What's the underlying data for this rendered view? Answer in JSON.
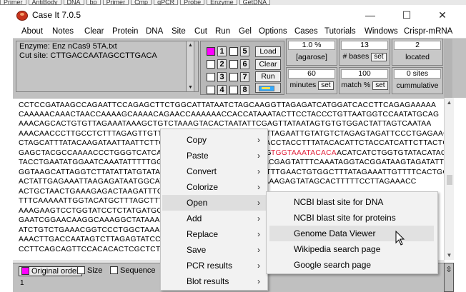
{
  "top_strip": [
    "Primer",
    "AntiBody",
    "DNA",
    "bp",
    "Primer",
    "Cmp",
    "qPCR",
    "Probe",
    "Enzyme",
    "GetDNA"
  ],
  "window": {
    "title": "Case It 7.0.5",
    "minimize": "—",
    "maximize": "☐",
    "close": "✕"
  },
  "menu": [
    "About",
    "Notes",
    "Clear",
    "Protein",
    "DNA",
    "Site",
    "Cut",
    "Run",
    "Gel",
    "Options",
    "Cases",
    "Tutorials",
    "Windows",
    "Crispr-mRNA"
  ],
  "info": {
    "line1": "Enzyme: Enz nCas9 5TA.txt",
    "line2": "Cut site: CTTGACCAATAGCCTTGACA"
  },
  "lanes": [
    "1",
    "2",
    "3",
    "4",
    "5",
    "6",
    "7",
    "8"
  ],
  "lane_buttons": {
    "load": "Load",
    "clear": "Clear",
    "run": "Run"
  },
  "params": {
    "agarose_value": "1.0 %",
    "agarose_label": "[agarose]",
    "bases_value": "13",
    "bases_label": "# bases",
    "located_value": "2",
    "located_label": "located",
    "minutes_value": "60",
    "minutes_label": "minutes",
    "match_value": "100",
    "match_label": "match %",
    "sites_value": "0 sites",
    "sites_label": "cummulative",
    "set_label": "set"
  },
  "sequence": [
    {
      "text": "CCTCCGATAAGCCAGAATTCCAGAGCTTCTGGCATTATAATCTAGCAAGGTTAGAGATCATGGATCACCTTCAGAGAAAAA",
      "red": false
    },
    {
      "text": "CAAAAACAAACTAACCAAAAGCAAAACAGAACCAAAAAACCACCATAAATACTTCCTACCCTGTTAATGGTCCAATATGCAG",
      "red": false
    },
    {
      "text": "AAACAGCACTGTGTTAGAAATAAAGCTGTCTAAAGTACACTAATATTCGAGTTATAATAGTGTGTGGACTATTAGTCAATAA",
      "red": false
    },
    {
      "text": "AAACAACCCTTGCCTCTTTAGAGTTGTTTGTGGTGTTACTTAATGGGCTTAGAATTGTATGTCTAGAGTAGATTCCCTGAGAAGTGAAC",
      "red": false
    },
    {
      "text": "CTAGCATTTATACAAGATAATTAATTCTTCATTCAAGCTATAGAATACGGACCTACCTTTATACACATTCTACCATCATTCTTACTGAGCATAGAA",
      "red": false
    },
    {
      "text": "GAGCTACGCCAAAACCCTGGGTCATCAGAAGCTTGACCAATAGCCTTGACATGGTAAATACACATCATCTGGTGTATACATACA",
      "red": false
    },
    {
      "text": "TACCTGAATATGGAATCAAATATTTTTGGCAATTCAGTTGGCCTCTATAACGAGTATTTCAAATAGGTACGGATAAGTAGATATTGA",
      "red": false
    },
    {
      "text": "GGTAAGCATTAGGTCTTATATTATGTATAGACTATACTCAACTGTAAACTTTTGAACTGTGGCTTTATAGAAATTGTTTTCACTGC",
      "red": false
    },
    {
      "text": "ACTATTGAGAAATTAAGAGATAATGGCATAACAACCCTGTCAGAAAAGAAAGAGTATAGCACTTTTTCCTTAGAAACC",
      "red": false
    },
    {
      "text": "ACTGCTAACTGAAAGAGACTAAGATTTCCAAAGAAAGTACAAAGC",
      "red": false
    },
    {
      "text": "TTTCAAAAATTGGTACATGCTTTAGCTTTCACATTTCAAGGTGC",
      "red": false
    },
    {
      "text": "AAAGAAGTCCTGGTATCCTCTATGATGCTTTTATAATAAATCAG",
      "red": false
    },
    {
      "text": "GAATCGGAACAAGGCAAAGGCTATAAAGCAGTGTTTCAATACCTT",
      "red": false
    },
    {
      "text": "ATCTGTCTGAAACGGTCCCTGGCTAAAGCATGGAATAATCTCAGG",
      "red": false
    },
    {
      "text": "AAACTTGACCAATAGTCTTAGAGTATCCTCTCTCTTCAGACCTTT",
      "red": false
    },
    {
      "text": "CCTTCAGCAGTTCCACACACTCGCTCTAATTAGGACGATGCTGTGT",
      "red": false
    }
  ],
  "highlight": {
    "text": "TGGTAAATACACA",
    "color": "#e0203a"
  },
  "context_menu": [
    "Copy",
    "Paste",
    "Convert",
    "Colorize",
    "Open",
    "Add",
    "Replace",
    "Save",
    "PCR results",
    "Blot results"
  ],
  "context_active": "Open",
  "submenu": [
    "NCBI blast site for DNA",
    "NCBI blast site for proteins",
    "Genome Data Viewer",
    "Wikipedia search page",
    "Google search page"
  ],
  "submenu_hover": "Genome Data Viewer",
  "bottom": {
    "original_order": "Original order",
    "size": "Size",
    "sequence": "Sequence",
    "status_value": "1"
  },
  "colors": {
    "accent_magenta": "#ff00ff",
    "panel_gray": "#c0c0c0",
    "highlight_red": "#e0203a"
  }
}
